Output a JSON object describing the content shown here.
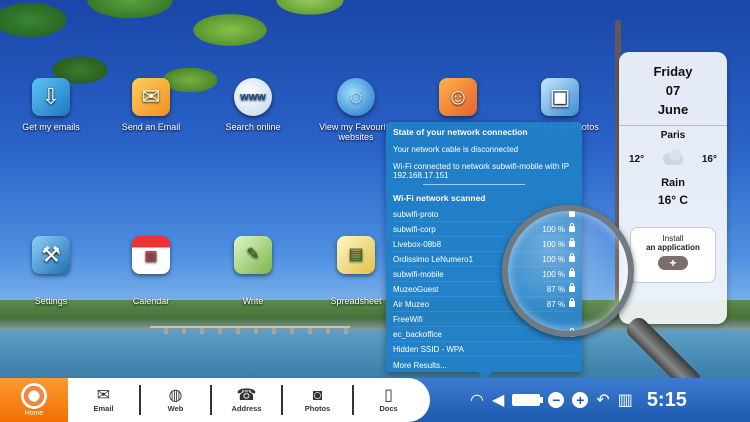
{
  "desktop_icons": {
    "emails": {
      "label": "Get my emails",
      "icon": "inbox-icon"
    },
    "send_email": {
      "label": "Send an Email",
      "icon": "envelope-icon"
    },
    "search": {
      "label": "Search online",
      "icon": "www-globe-icon"
    },
    "favourite_websites": {
      "label": "View my Favourite websites",
      "icon": "globe-icon"
    },
    "settings": {
      "label": "Settings",
      "icon": "tools-icon"
    },
    "calendar": {
      "label": "Calendar",
      "icon": "calendar-icon"
    },
    "write": {
      "label": "Write",
      "icon": "document-icon"
    },
    "spreadsheet": {
      "label": "Spreadsheet",
      "icon": "spreadsheet-icon"
    },
    "photos": {
      "label": "Look for My Photos",
      "icon": "photos-icon"
    }
  },
  "weather": {
    "day": "Friday",
    "date": "07",
    "month": "June",
    "city": "Paris",
    "temp_low": "12°",
    "temp_high": "16°",
    "condition": "Rain",
    "current_temp": "16° C"
  },
  "install_app": {
    "line1": "Install",
    "line2": "an application",
    "button": "+"
  },
  "network": {
    "state_title": "State of your network connection",
    "cable_msg": "Your network cable is disconnected",
    "wifi_msg": "Wi-Fi connected to network subwifi-mobile with IP 192.168.17.151",
    "scanned_title": "Wi-Fi network scanned",
    "networks": [
      {
        "ssid": "subwifi-proto",
        "signal": "",
        "locked": true
      },
      {
        "ssid": "subwifi-corp",
        "signal": "100 %",
        "locked": true
      },
      {
        "ssid": "Livebox-08b8",
        "signal": "100 %",
        "locked": true
      },
      {
        "ssid": "Ordissimo LeNumero1",
        "signal": "100 %",
        "locked": true
      },
      {
        "ssid": "subwifi-mobile",
        "signal": "100 %",
        "locked": true
      },
      {
        "ssid": "MuzeoGuest",
        "signal": "87 %",
        "locked": true
      },
      {
        "ssid": "Air Muzeo",
        "signal": "87 %",
        "locked": true
      },
      {
        "ssid": "FreeWifi",
        "signal": "",
        "locked": false
      },
      {
        "ssid": "ec_backoffice",
        "signal": "",
        "locked": true
      },
      {
        "ssid": "Hidden SSID - WPA",
        "signal": "",
        "locked": false
      }
    ],
    "more_label": "More Results..."
  },
  "dock": {
    "home": "Home",
    "email": "Email",
    "web": "Web",
    "address": "Address",
    "photos": "Photos",
    "docs": "Docs"
  },
  "tray": {
    "time": "5:15"
  },
  "colors": {
    "accent_orange": "#f07000",
    "taskbar_blue": "#1e5bb0",
    "panel_blue": "#2080c8"
  }
}
